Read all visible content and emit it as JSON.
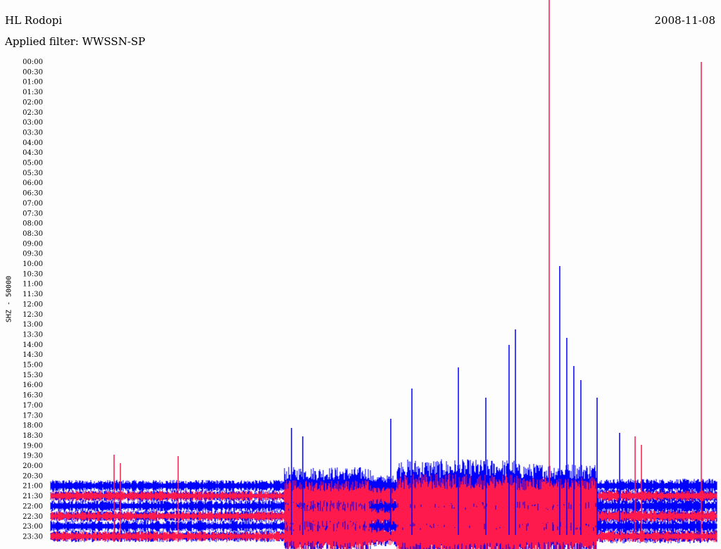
{
  "header": {
    "station": "HL Rodopi",
    "filter": "Applied filter: WWSSN-SP",
    "date": "2008-11-08"
  },
  "colors": {
    "blue": "#0000ff",
    "red": "#ff1a4d",
    "background": "#fdfdfd"
  },
  "chart_data": {
    "type": "line",
    "title": "HL Rodopi",
    "subtitle": "Applied filter: WWSSN-SP",
    "ylabel": "SHZ - 50000",
    "xlabel": "",
    "grid": false,
    "y_ticks": [
      "00:00",
      "00:30",
      "01:00",
      "01:30",
      "02:00",
      "02:30",
      "03:00",
      "03:30",
      "04:00",
      "04:30",
      "05:00",
      "05:30",
      "06:00",
      "06:30",
      "07:00",
      "07:30",
      "08:00",
      "08:30",
      "09:00",
      "09:30",
      "10:00",
      "10:30",
      "11:00",
      "11:30",
      "12:00",
      "12:30",
      "13:00",
      "13:30",
      "14:00",
      "14:30",
      "15:00",
      "15:30",
      "16:00",
      "16:30",
      "17:00",
      "17:30",
      "18:00",
      "18:30",
      "19:00",
      "19:30",
      "20:00",
      "20:30",
      "21:00",
      "21:30",
      "22:00",
      "22:30",
      "23:00",
      "23:30"
    ],
    "series": [
      {
        "name": "",
        "color": "blue",
        "traces": [
          "21:00",
          "21:30",
          "22:00",
          "22:30",
          "23:00",
          "23:30"
        ]
      },
      {
        "name": "",
        "color": "red",
        "traces": [
          "21:30",
          "22:30",
          "23:30"
        ]
      }
    ]
  }
}
